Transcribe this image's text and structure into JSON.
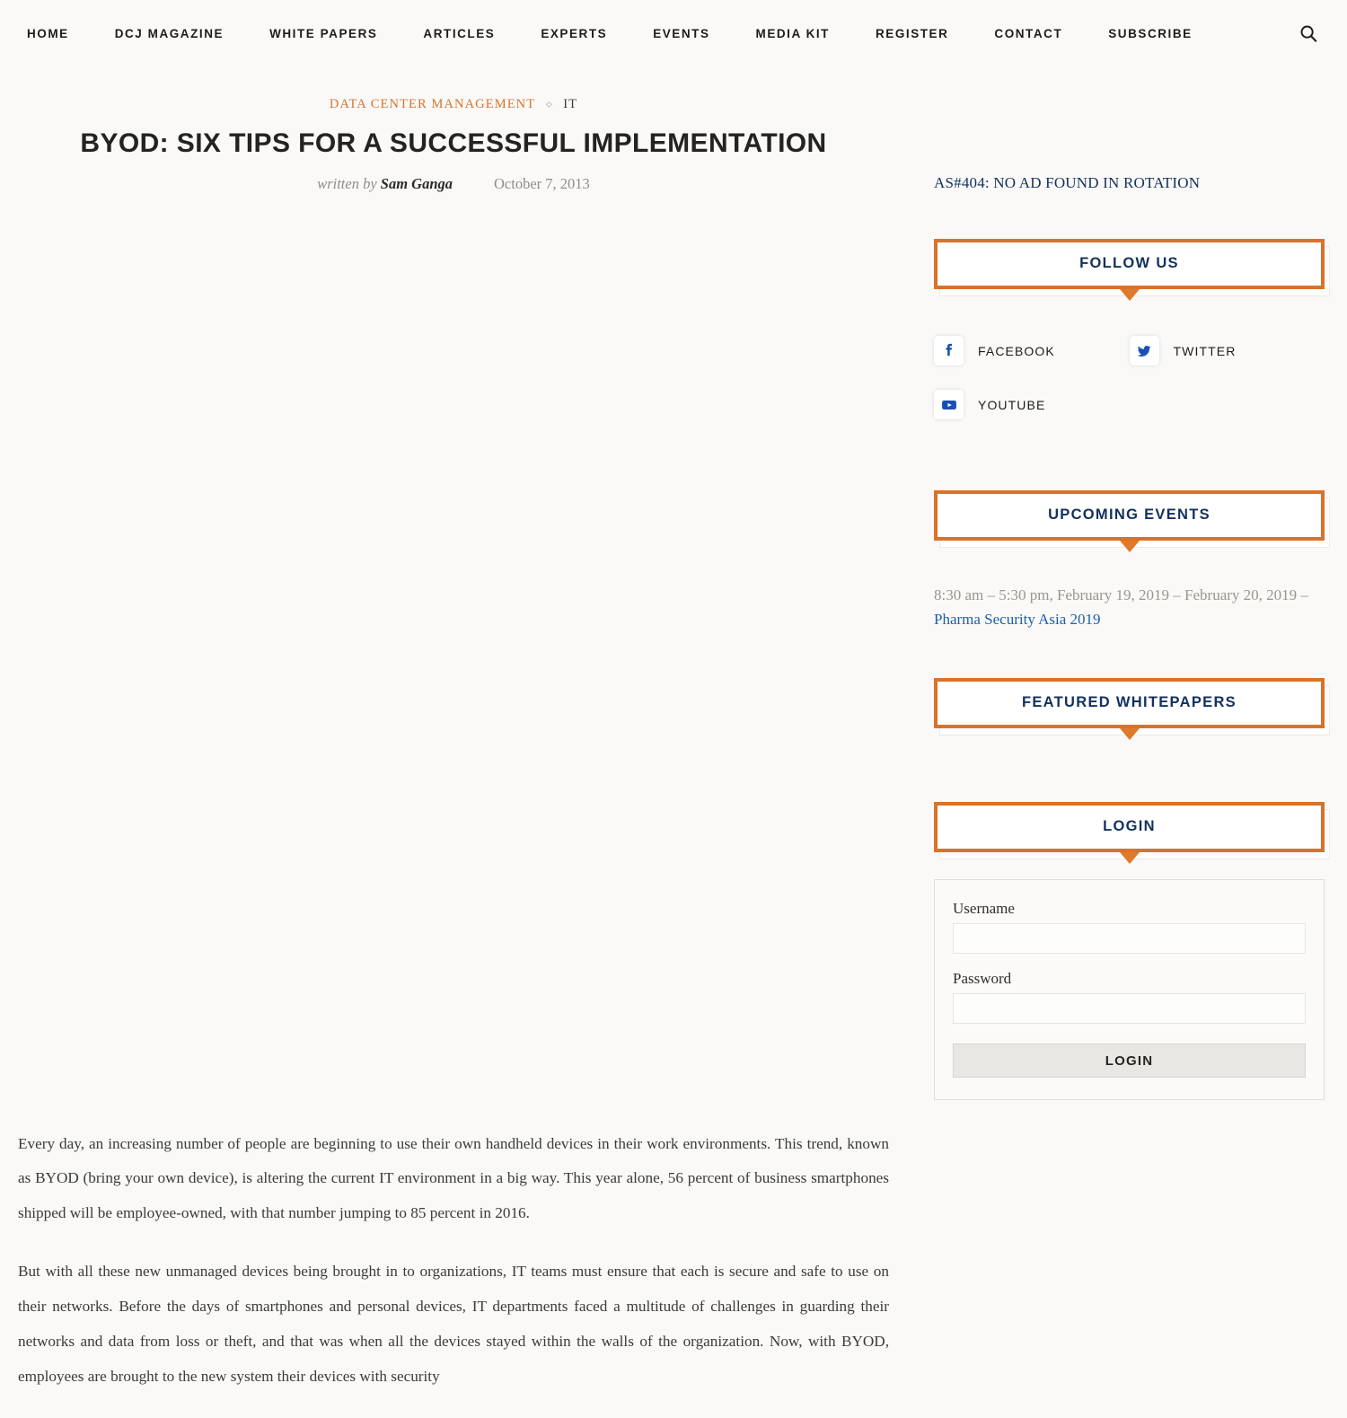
{
  "nav": {
    "items": [
      {
        "label": "HOME"
      },
      {
        "label": "DCJ MAGAZINE"
      },
      {
        "label": "WHITE PAPERS"
      },
      {
        "label": "ARTICLES"
      },
      {
        "label": "EXPERTS"
      },
      {
        "label": "EVENTS"
      },
      {
        "label": "MEDIA KIT"
      },
      {
        "label": "REGISTER"
      },
      {
        "label": "CONTACT"
      },
      {
        "label": "SUBSCRIBE"
      }
    ],
    "search_icon": "search-icon"
  },
  "article": {
    "breadcrumb": {
      "primary": "DATA CENTER MANAGEMENT",
      "separator": "◆",
      "secondary": "IT"
    },
    "title": "BYOD: SIX TIPS FOR A SUCCESSFUL IMPLEMENTATION",
    "written_by_label": "written by",
    "author": "Sam Ganga",
    "date": "October 7, 2013",
    "paragraphs": [
      "Every day, an increasing number of people are beginning to use their own handheld devices in their work environments. This trend, known as BYOD (bring your own device), is altering the current IT environment in a big way. This year alone, 56 percent of business smartphones shipped will be employee-owned, with that number jumping to 85 percent in 2016.",
      "But with all these new unmanaged devices being brought in to organizations, IT teams must ensure that each is secure and safe to use on their networks. Before the days of smartphones and personal devices, IT departments faced a multitude of challenges in guarding their networks and data from loss or theft, and that was when all the devices stayed within the walls of the organization. Now, with BYOD, employees are brought to the new system their devices with security"
    ]
  },
  "sidebar": {
    "ad_notice": "AS#404: NO AD FOUND IN ROTATION",
    "follow_us": {
      "title": "FOLLOW US",
      "channels": [
        {
          "label": "FACEBOOK",
          "icon": "facebook-icon"
        },
        {
          "label": "TWITTER",
          "icon": "twitter-icon"
        },
        {
          "label": "YOUTUBE",
          "icon": "youtube-icon"
        }
      ]
    },
    "upcoming_events": {
      "title": "UPCOMING EVENTS",
      "entry_time_range": "8:30 am – 5:30 pm, February 19, 2019 – February 20, 2019 – ",
      "entry_link": "Pharma Security Asia 2019"
    },
    "featured_whitepapers": {
      "title": "FEATURED WHITEPAPERS"
    },
    "login": {
      "title": "LOGIN",
      "username_label": "Username",
      "username_value": "",
      "password_label": "Password",
      "password_value": "",
      "submit_label": "LOGIN"
    }
  },
  "colors": {
    "accent_orange": "#d9722a",
    "link_blue": "#1d5fa8",
    "heading_navy": "#13315c",
    "page_background": "#faf9f7",
    "body_text": "#3b3b3b"
  }
}
